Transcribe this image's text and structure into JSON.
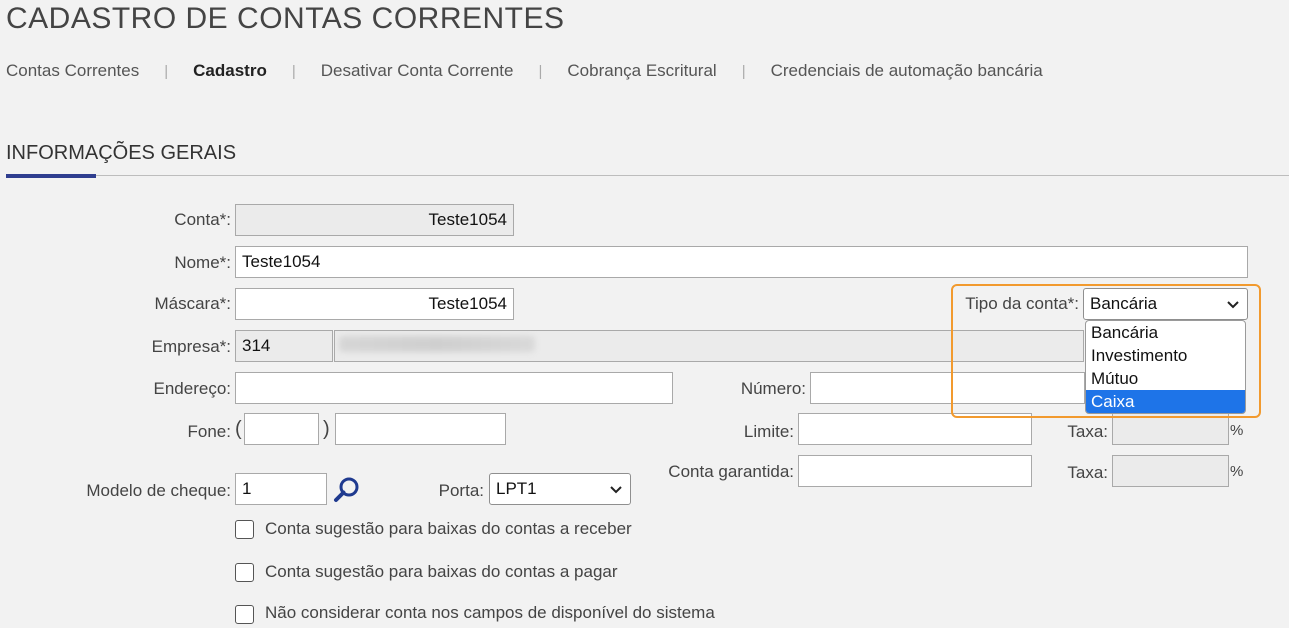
{
  "page": {
    "title": "CADASTRO DE CONTAS CORRENTES"
  },
  "tabs": [
    {
      "label": "Contas Correntes"
    },
    {
      "label": "Cadastro"
    },
    {
      "label": "Desativar Conta Corrente"
    },
    {
      "label": "Cobrança Escritural"
    },
    {
      "label": "Credenciais de automação bancária"
    }
  ],
  "tab_separator": "|",
  "section": {
    "title": "INFORMAÇÕES GERAIS"
  },
  "form": {
    "conta": {
      "label": "Conta*:",
      "value": "Teste1054"
    },
    "nome": {
      "label": "Nome*:",
      "value": "Teste1054"
    },
    "mascara": {
      "label": "Máscara*:",
      "value": "Teste1054"
    },
    "tipo_conta": {
      "label": "Tipo da conta*:",
      "value": "Bancária",
      "options": [
        "Bancária",
        "Investimento",
        "Mútuo",
        "Caixa"
      ],
      "highlighted": "Caixa"
    },
    "empresa": {
      "label": "Empresa*:",
      "code": "314"
    },
    "endereco": {
      "label": "Endereço:",
      "value": ""
    },
    "numero": {
      "label": "Número:",
      "value": ""
    },
    "fone": {
      "label": "Fone:",
      "open_paren": "(",
      "close_paren": ")",
      "ddd": "",
      "number": ""
    },
    "limite": {
      "label": "Limite:",
      "value": ""
    },
    "taxa1": {
      "label": "Taxa:",
      "value": "",
      "unit": "%"
    },
    "conta_garantida": {
      "label": "Conta garantida:",
      "value": ""
    },
    "taxa2": {
      "label": "Taxa:",
      "value": "",
      "unit": "%"
    },
    "modelo_cheque": {
      "label": "Modelo de cheque:",
      "value": "1"
    },
    "porta": {
      "label": "Porta:",
      "value": "LPT1"
    },
    "checkboxes": [
      {
        "label": "Conta sugestão para baixas do contas a receber",
        "checked": false
      },
      {
        "label": "Conta sugestão para baixas do contas a pagar",
        "checked": false
      },
      {
        "label": "Não considerar conta nos campos de disponível do sistema",
        "checked": false
      }
    ]
  },
  "colors": {
    "accent": "#2f3e8f",
    "highlight": "#f29a2e",
    "selected_option": "#1e74e8"
  }
}
